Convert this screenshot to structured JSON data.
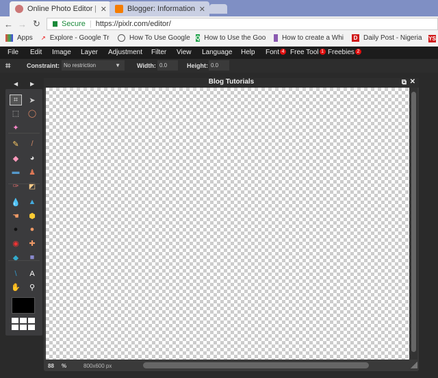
{
  "browser": {
    "tabs": [
      {
        "title": "Online Photo Editor | Pixlr"
      },
      {
        "title": "Blogger: Information Guide"
      }
    ],
    "secure_label": "Secure",
    "url": "https://pixlr.com/editor/",
    "bookmarks": [
      "Apps",
      "Explore - Google Tre",
      "How To Use Google",
      "How to Use the Goo",
      "How to create a Whi",
      "Daily Post - Nigeria"
    ]
  },
  "menu": [
    {
      "label": "File"
    },
    {
      "label": "Edit"
    },
    {
      "label": "Image"
    },
    {
      "label": "Layer"
    },
    {
      "label": "Adjustment"
    },
    {
      "label": "Filter"
    },
    {
      "label": "View"
    },
    {
      "label": "Language"
    },
    {
      "label": "Help"
    },
    {
      "label": "Font",
      "badge": "4"
    },
    {
      "label": "Free Tool",
      "badge": "1"
    },
    {
      "label": "Freebies",
      "badge": "2"
    }
  ],
  "options": {
    "constraint_label": "Constraint:",
    "constraint_value": "No restriction",
    "width_label": "Width:",
    "width_value": "0.0",
    "height_label": "Height:",
    "height_value": "0.0"
  },
  "toolbox": {
    "tools": [
      "crop",
      "move",
      "marquee",
      "lasso",
      "magic-wand",
      "pencil",
      "brush",
      "eraser",
      "paint-bucket",
      "gradient",
      "clone-stamp",
      "color-replace",
      "drawing",
      "blur",
      "sharpen",
      "smudge",
      "sponge",
      "burn",
      "dodge",
      "red-eye",
      "spot-heal",
      "bloat",
      "pinch",
      "color-picker",
      "type",
      "hand",
      "zoom"
    ],
    "primary_color": "#000000"
  },
  "document": {
    "title": "Blog Tutorials",
    "zoom": "88",
    "zoom_unit": "%",
    "size": "800x600 px"
  }
}
